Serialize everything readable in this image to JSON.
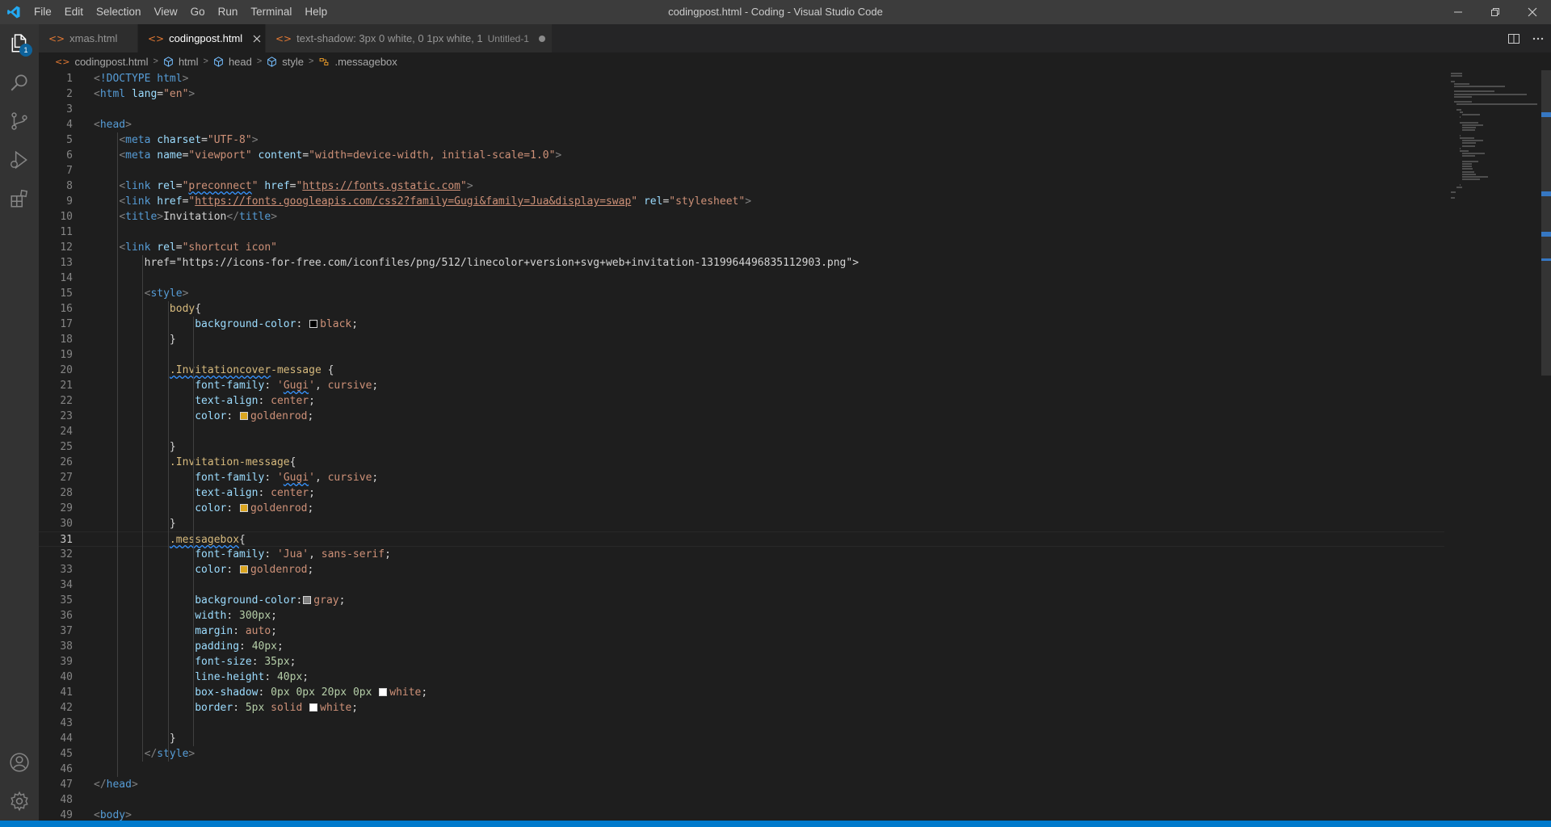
{
  "window": {
    "title": "codingpost.html - Coding - Visual Studio Code",
    "menu": [
      "File",
      "Edit",
      "Selection",
      "View",
      "Go",
      "Run",
      "Terminal",
      "Help"
    ]
  },
  "activity": {
    "explorer_badge": "1",
    "icons": [
      "files-icon",
      "search-icon",
      "source-control-icon",
      "run-debug-icon",
      "extensions-icon",
      "account-icon",
      "settings-gear-icon"
    ]
  },
  "tabs": [
    {
      "label": "xmas.html",
      "desc": "",
      "active": false,
      "dirty": false
    },
    {
      "label": "codingpost.html",
      "desc": "",
      "active": true,
      "dirty": false
    },
    {
      "label": "text-shadow: 3px 0 white, 0 1px white, 1",
      "desc": "Untitled-1",
      "active": false,
      "dirty": true
    }
  ],
  "breadcrumbs": [
    "codingpost.html",
    "html",
    "head",
    "style",
    ".messagebox"
  ],
  "editor": {
    "current_line": 31,
    "lines": [
      {
        "n": "1",
        "t": "<!DOCTYPE html>"
      },
      {
        "n": "2",
        "t": "<html lang=\"en\">"
      },
      {
        "n": "3",
        "t": ""
      },
      {
        "n": "4",
        "t": "<head>"
      },
      {
        "n": "5",
        "t": "    <meta charset=\"UTF-8\">"
      },
      {
        "n": "6",
        "t": "    <meta name=\"viewport\" content=\"width=device-width, initial-scale=1.0\">"
      },
      {
        "n": "7",
        "t": ""
      },
      {
        "n": "8",
        "t": "    <link rel=\"preconnect\" href=\"https://fonts.gstatic.com\">"
      },
      {
        "n": "9",
        "t": "    <link href=\"https://fonts.googleapis.com/css2?family=Gugi&family=Jua&display=swap\" rel=\"stylesheet\">"
      },
      {
        "n": "10",
        "t": "    <title>Invitation</title>"
      },
      {
        "n": "11",
        "t": ""
      },
      {
        "n": "12",
        "t": "    <link rel=\"shortcut icon\""
      },
      {
        "n": "13",
        "t": "        href=\"https://icons-for-free.com/iconfiles/png/512/linecolor+version+svg+web+invitation-1319964496835112903.png\">"
      },
      {
        "n": "14",
        "t": ""
      },
      {
        "n": "15",
        "t": "        <style>"
      },
      {
        "n": "16",
        "t": "            body{"
      },
      {
        "n": "17",
        "t": "                background-color: black;"
      },
      {
        "n": "18",
        "t": "            }"
      },
      {
        "n": "19",
        "t": ""
      },
      {
        "n": "20",
        "t": "            .Invitationcover-message {"
      },
      {
        "n": "21",
        "t": "                font-family: 'Gugi', cursive;"
      },
      {
        "n": "22",
        "t": "                text-align: center;"
      },
      {
        "n": "23",
        "t": "                color: goldenrod;"
      },
      {
        "n": "24",
        "t": ""
      },
      {
        "n": "25",
        "t": "            }"
      },
      {
        "n": "26",
        "t": "            .Invitation-message{"
      },
      {
        "n": "27",
        "t": "                font-family: 'Gugi', cursive;"
      },
      {
        "n": "28",
        "t": "                text-align: center;"
      },
      {
        "n": "29",
        "t": "                color: goldenrod;"
      },
      {
        "n": "30",
        "t": "            }"
      },
      {
        "n": "31",
        "t": "            .messagebox{"
      },
      {
        "n": "32",
        "t": "                font-family: 'Jua', sans-serif;"
      },
      {
        "n": "33",
        "t": "                color: goldenrod;"
      },
      {
        "n": "34",
        "t": ""
      },
      {
        "n": "35",
        "t": "                background-color:gray;"
      },
      {
        "n": "36",
        "t": "                width: 300px;"
      },
      {
        "n": "37",
        "t": "                margin: auto;"
      },
      {
        "n": "38",
        "t": "                padding: 40px;"
      },
      {
        "n": "39",
        "t": "                font-size: 35px;"
      },
      {
        "n": "40",
        "t": "                line-height: 40px;"
      },
      {
        "n": "41",
        "t": "                box-shadow: 0px 0px 20px 0px white;"
      },
      {
        "n": "42",
        "t": "                border: 5px solid white;"
      },
      {
        "n": "43",
        "t": ""
      },
      {
        "n": "44",
        "t": "            }"
      },
      {
        "n": "45",
        "t": "        </style>"
      },
      {
        "n": "46",
        "t": ""
      },
      {
        "n": "47",
        "t": "</head>"
      },
      {
        "n": "48",
        "t": ""
      },
      {
        "n": "49",
        "t": "<body>"
      }
    ]
  },
  "colors": {
    "accent": "#007acc",
    "swatch_black": "#000000",
    "swatch_goldenrod": "#daa520",
    "swatch_gray": "#808080",
    "swatch_white": "#ffffff"
  }
}
